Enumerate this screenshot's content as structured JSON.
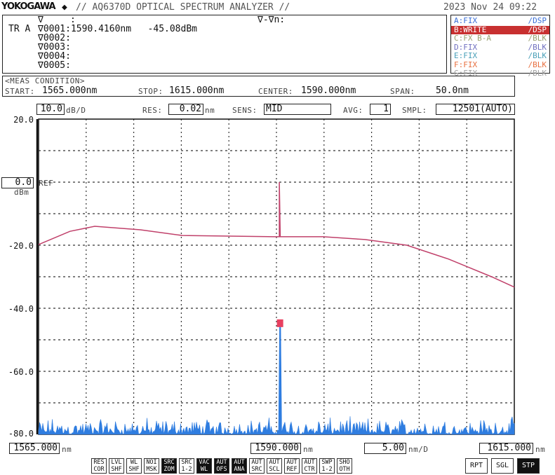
{
  "header": {
    "brand": "YOKOGAWA",
    "title": "// AQ6370D OPTICAL SPECTRUM ANALYZER //",
    "datetime": "2023 Nov 24 09:22"
  },
  "markers": {
    "col_head": "∇",
    "sep": ":",
    "delta_head": "∇-∇n:",
    "trace": "TR A",
    "rows": [
      {
        "id": "∇0001",
        "value": "1590.4160nm   -45.08dBm"
      },
      {
        "id": "∇0002",
        "value": ""
      },
      {
        "id": "∇0003",
        "value": ""
      },
      {
        "id": "∇0004",
        "value": ""
      },
      {
        "id": "∇0005",
        "value": ""
      }
    ]
  },
  "traces": [
    {
      "left": "A:FIX",
      "right": "/DSP",
      "color": "#3a6fd8",
      "active": false
    },
    {
      "left": "B:WRITE",
      "right": "/DSP",
      "color": "#ffffff",
      "active": true
    },
    {
      "left": "C:FX B-A",
      "right": "/BLK",
      "color": "#9aa070",
      "active": false
    },
    {
      "left": "D:FIX",
      "right": "/BLK",
      "color": "#7070c0",
      "active": false
    },
    {
      "left": "E:FIX",
      "right": "/BLK",
      "color": "#4aa0b8",
      "active": false
    },
    {
      "left": "F:FIX",
      "right": "/BLK",
      "color": "#e87040",
      "active": false
    },
    {
      "left": "G:FIX",
      "right": "/BLK",
      "color": "#a0a0a0",
      "active": false
    }
  ],
  "meas": {
    "title": "<MEAS CONDITION>",
    "start_label": "START:",
    "start": "1565.000nm",
    "stop_label": "STOP:",
    "stop": "1615.000nm",
    "center_label": "CENTER:",
    "center": "1590.000nm",
    "span_label": "SPAN:",
    "span": "50.0nm"
  },
  "settings": {
    "scale": "10.0",
    "scale_unit": "dB/D",
    "res_label": "RES:",
    "res": "0.02",
    "res_unit": "nm",
    "sens_label": "SENS:",
    "sens": "MID",
    "avg_label": "AVG:",
    "avg": "1",
    "smpl_label": "SMPL:",
    "smpl": "12501(AUTO)"
  },
  "ref": {
    "value": "0.0",
    "label": "REF",
    "unit": "dBm"
  },
  "bottom": {
    "start": "1565.000",
    "start_unit": "nm",
    "center": "1590.000",
    "center_unit": "nm",
    "span_div": "5.00",
    "span_div_unit": "nm/D",
    "stop": "1615.000",
    "stop_unit": "nm"
  },
  "softkeys": [
    {
      "l1": "RES",
      "l2": "COR",
      "on": false
    },
    {
      "l1": "LVL",
      "l2": "SHF",
      "on": false
    },
    {
      "l1": "WL",
      "l2": "SHF",
      "on": false
    },
    {
      "l1": "NOI",
      "l2": "MSK",
      "on": false
    },
    {
      "l1": "SRC",
      "l2": "ZOM",
      "on": true
    },
    {
      "l1": "SRC",
      "l2": "1-2",
      "on": false
    },
    {
      "l1": "VAC",
      "l2": "WL",
      "on": true
    },
    {
      "l1": "AUT",
      "l2": "OFS",
      "on": true
    },
    {
      "l1": "AUT",
      "l2": "ANA",
      "on": true
    },
    {
      "l1": "AUT",
      "l2": "SRC",
      "on": false
    },
    {
      "l1": "AUT",
      "l2": "SCL",
      "on": false
    },
    {
      "l1": "AUT",
      "l2": "REF",
      "on": false
    },
    {
      "l1": "AUT",
      "l2": "CTR",
      "on": false
    },
    {
      "l1": "SWP",
      "l2": "1-2",
      "on": false
    },
    {
      "l1": "SHO",
      "l2": "OTH",
      "on": false
    }
  ],
  "sweep_buttons": [
    {
      "label": "RPT",
      "on": false
    },
    {
      "label": "SGL",
      "on": false
    },
    {
      "label": "STP",
      "on": true
    }
  ],
  "chart_data": {
    "type": "line",
    "xlim": [
      1565,
      1615
    ],
    "ylim": [
      -80,
      20
    ],
    "xunit": "nm",
    "yunit": "dBm",
    "grid": true,
    "yticks": [
      "20.0",
      "-20.0",
      "-40.0",
      "-60.0",
      "-80.0"
    ],
    "series": [
      {
        "color": "#c0406a",
        "x": [
          1565,
          1568.3,
          1570.9,
          1575.7,
          1580.1,
          1589.7,
          1590.3,
          1590.3,
          1590.4,
          1594.9,
          1599.3,
          1603.7,
          1608.1,
          1612.6,
          1615
        ],
        "y": [
          -19.8,
          -15.6,
          -14.0,
          -15.1,
          -16.9,
          -17.3,
          -17.3,
          0,
          -17.3,
          -17.3,
          -18.2,
          -20,
          -24.4,
          -30,
          -33.3
        ]
      },
      {
        "color": "#2f7de0",
        "noise_floor_dbm": -78,
        "peak": {
          "x": 1590.416,
          "y": -45.08
        }
      }
    ],
    "marker": {
      "x": 1590.416,
      "y": -45.08,
      "color": "#e84060"
    }
  }
}
